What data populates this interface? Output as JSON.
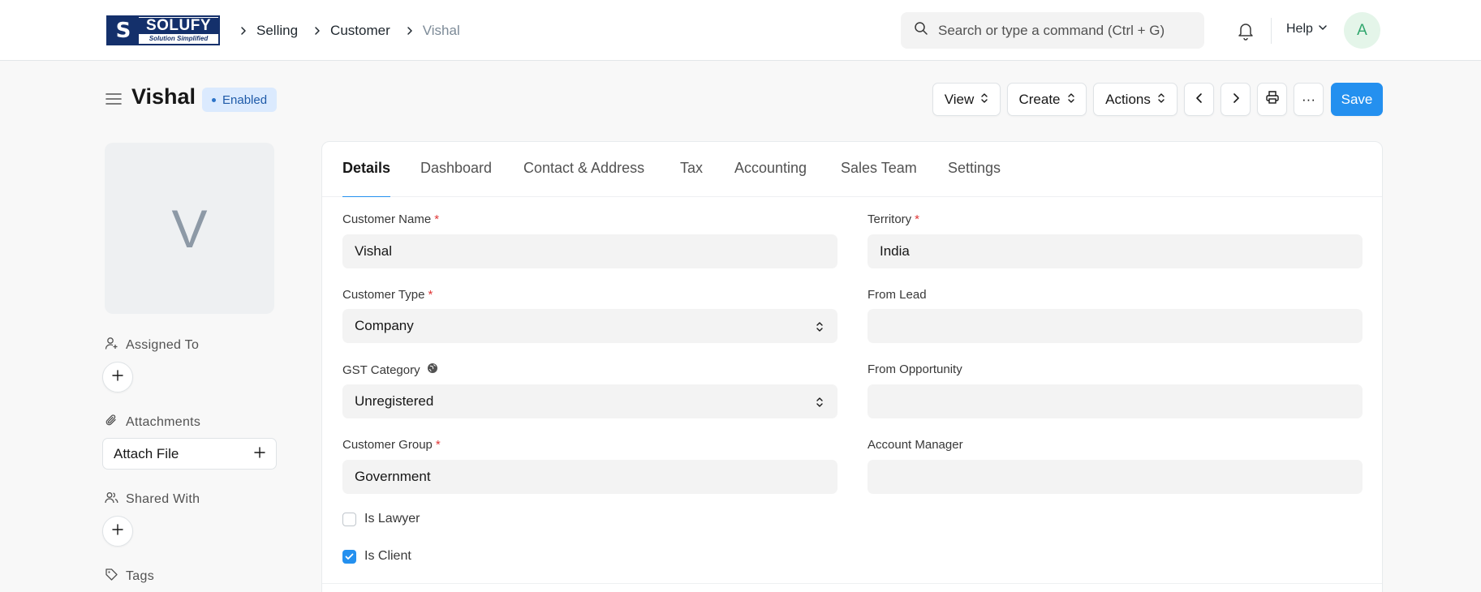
{
  "brand": {
    "logo_name": "SOLUFY",
    "logo_tagline": "Solution Simplified"
  },
  "breadcrumbs": [
    "Selling",
    "Customer",
    "Vishal"
  ],
  "search": {
    "placeholder": "Search or type a command (Ctrl + G)"
  },
  "navbar": {
    "help_label": "Help",
    "user_initial": "A"
  },
  "page": {
    "title": "Vishal",
    "status": "Enabled",
    "buttons": {
      "view": "View",
      "create": "Create",
      "actions": "Actions",
      "more": "···",
      "save": "Save"
    }
  },
  "sidebar": {
    "avatar_initial": "V",
    "assigned_to_label": "Assigned To",
    "attachments_label": "Attachments",
    "attach_file_label": "Attach File",
    "shared_with_label": "Shared With",
    "tags_label": "Tags"
  },
  "tabs": [
    "Details",
    "Dashboard",
    "Contact & Address",
    "Tax",
    "Accounting",
    "Sales Team",
    "Settings"
  ],
  "form": {
    "customer_name": {
      "label": "Customer Name",
      "value": "Vishal"
    },
    "territory": {
      "label": "Territory",
      "value": "India"
    },
    "customer_type": {
      "label": "Customer Type",
      "value": "Company"
    },
    "from_lead": {
      "label": "From Lead",
      "value": ""
    },
    "gst_category": {
      "label": "GST Category",
      "value": "Unregistered"
    },
    "from_opportunity": {
      "label": "From Opportunity",
      "value": ""
    },
    "customer_group": {
      "label": "Customer Group",
      "value": "Government"
    },
    "account_manager": {
      "label": "Account Manager",
      "value": ""
    },
    "is_lawyer": {
      "label": "Is Lawyer",
      "checked": false
    },
    "is_client": {
      "label": "Is Client",
      "checked": true
    }
  },
  "colors": {
    "primary": "#2490ef",
    "brand_navy": "#14306b",
    "required": "#e03636"
  }
}
